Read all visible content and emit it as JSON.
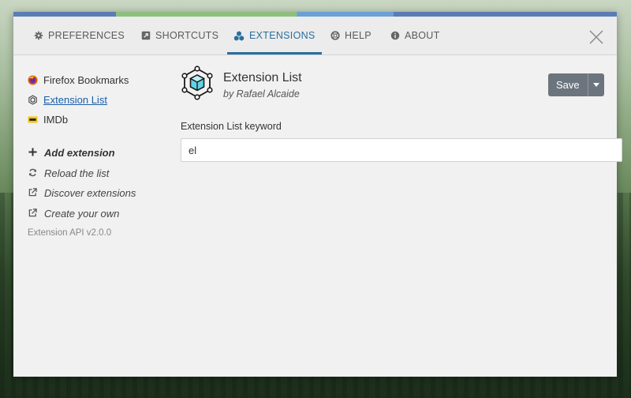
{
  "tabs": [
    {
      "label": "PREFERENCES",
      "icon": "gear-icon"
    },
    {
      "label": "SHORTCUTS",
      "icon": "shortcut-icon"
    },
    {
      "label": "EXTENSIONS",
      "icon": "extensions-icon"
    },
    {
      "label": "HELP",
      "icon": "lifebuoy-icon"
    },
    {
      "label": "ABOUT",
      "icon": "info-icon"
    }
  ],
  "active_tab": "EXTENSIONS",
  "sidebar": {
    "items": [
      {
        "label": "Firefox Bookmarks",
        "icon": "firefox-icon"
      },
      {
        "label": "Extension List",
        "icon": "extension-list-icon"
      },
      {
        "label": "IMDb",
        "icon": "imdb-icon"
      }
    ],
    "actions": [
      {
        "label": "Add extension",
        "icon": "plus-icon"
      },
      {
        "label": "Reload the list",
        "icon": "reload-icon"
      },
      {
        "label": "Discover extensions",
        "icon": "external-link-icon"
      },
      {
        "label": "Create your own",
        "icon": "external-link-icon"
      }
    ],
    "api_version": "Extension API v2.0.0"
  },
  "extension": {
    "title": "Extension List",
    "author": "by Rafael Alcaide",
    "icon": "cube-network-icon"
  },
  "save": {
    "label": "Save"
  },
  "keyword": {
    "label": "Extension List keyword",
    "value": "el"
  },
  "colors": {
    "accent": "#2a6e9e",
    "link": "#1b5fa8",
    "button": "#6c757d"
  }
}
